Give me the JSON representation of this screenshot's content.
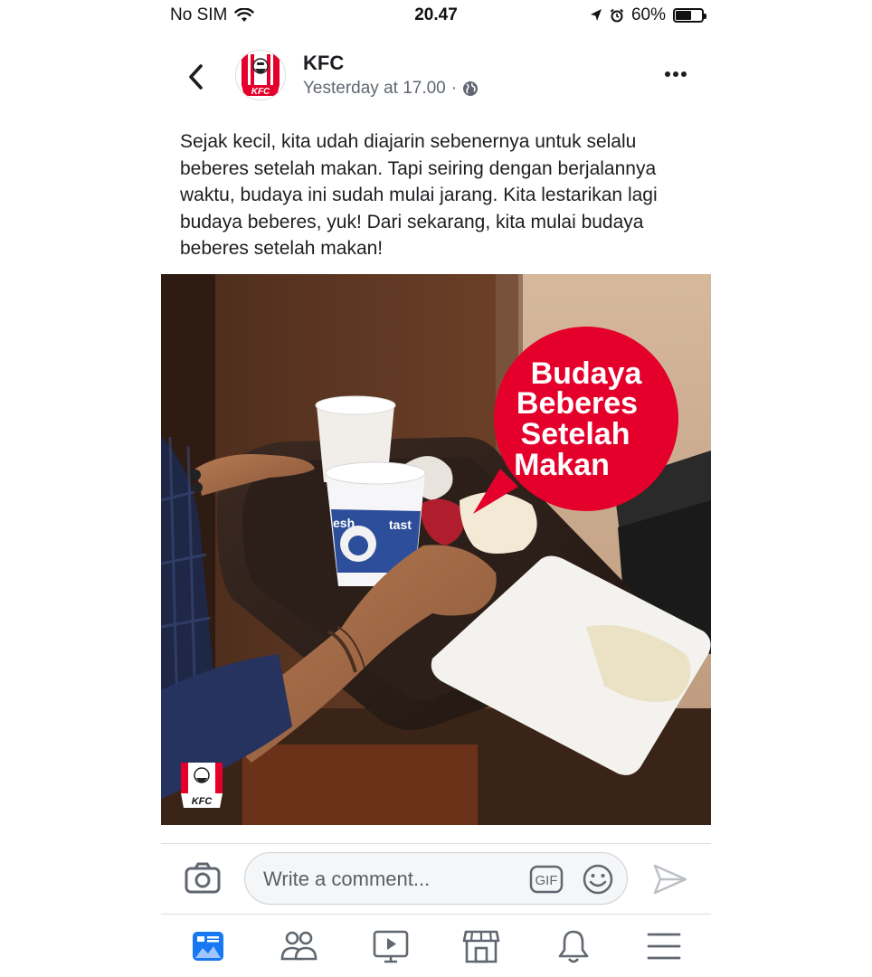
{
  "status_bar": {
    "carrier": "No SIM",
    "time": "20.47",
    "battery_percent": "60%",
    "battery_level": 0.6
  },
  "post": {
    "page_name": "KFC",
    "timestamp": "Yesterday at 17.00",
    "meta_separator": "·",
    "privacy_icon": "globe-icon",
    "text": "Sejak kecil, kita udah diajarin sebenernya untuk selalu beberes setelah makan. Tapi seiring dengan berjalannya waktu, budaya ini sudah mulai jarang. Kita lestarikan lagi budaya beberes, yuk! Dari sekarang, kita mulai budaya beberes setelah makan!",
    "image": {
      "bubble_line1": "Budaya",
      "bubble_line2": "Beberes",
      "bubble_line3": "Setelah",
      "bubble_line4": "Makan",
      "cup_print": "tast",
      "cup_print2": "esh",
      "watermark_text": "KFC"
    }
  },
  "avatar_logo_text": "KFC",
  "comment_bar": {
    "placeholder": "Write a comment...",
    "gif_label": "GIF"
  },
  "tab_bar": {
    "tabs": [
      "news-feed-icon",
      "friends-icon",
      "watch-icon",
      "marketplace-icon",
      "notifications-icon",
      "menu-icon"
    ],
    "active_tab": "news-feed-icon"
  },
  "colors": {
    "kfc_red": "#e4002b",
    "facebook_blue": "#1877f2",
    "text_primary": "#1c1e21",
    "text_secondary": "#606770",
    "icon_gray": "#606770"
  }
}
